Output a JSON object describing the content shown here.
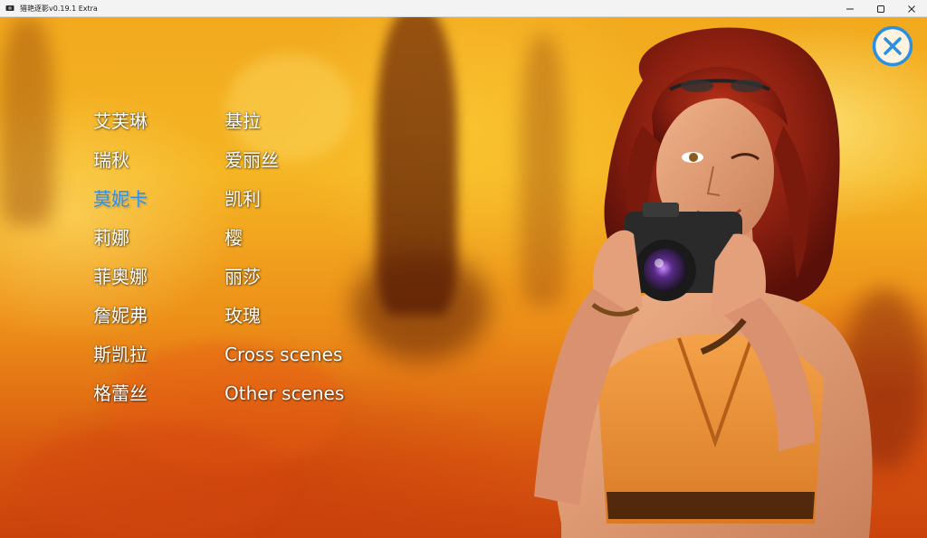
{
  "window": {
    "title": "猎艳逐影v0.19.1 Extra"
  },
  "menu": {
    "left_column": [
      {
        "label": "艾芙琳",
        "selected": false
      },
      {
        "label": "瑞秋",
        "selected": false
      },
      {
        "label": "莫妮卡",
        "selected": true
      },
      {
        "label": "莉娜",
        "selected": false
      },
      {
        "label": "菲奥娜",
        "selected": false
      },
      {
        "label": "詹妮弗",
        "selected": false
      },
      {
        "label": "斯凯拉",
        "selected": false
      },
      {
        "label": "格蕾丝",
        "selected": false
      }
    ],
    "right_column": [
      {
        "label": "基拉"
      },
      {
        "label": "爱丽丝"
      },
      {
        "label": "凯利"
      },
      {
        "label": "樱"
      },
      {
        "label": "丽莎"
      },
      {
        "label": "玫瑰"
      },
      {
        "label": "Cross scenes"
      },
      {
        "label": "Other scenes"
      }
    ]
  },
  "colors": {
    "menu_text": "#ffffff",
    "menu_selected": "#2c8fe0",
    "close_button": "#2c8fe0"
  },
  "icons": {
    "close": "close-circle-icon",
    "app": "app-icon",
    "minimize": "minimize-icon",
    "maximize": "maximize-icon",
    "window_close": "window-close-icon"
  }
}
